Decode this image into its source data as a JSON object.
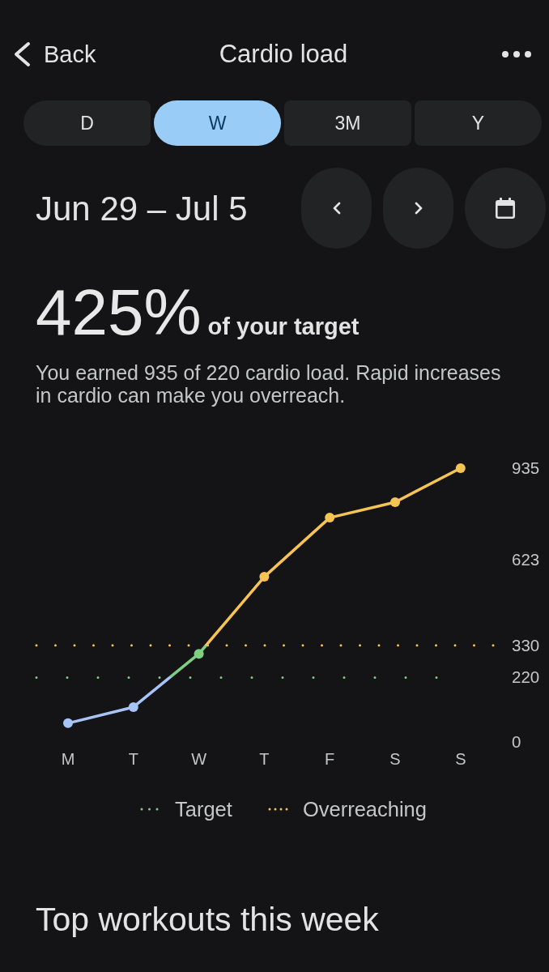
{
  "header": {
    "back": "Back",
    "title": "Cardio load"
  },
  "tabs": [
    {
      "label": "D",
      "selected": false
    },
    {
      "label": "W",
      "selected": true
    },
    {
      "label": "3M",
      "selected": false
    },
    {
      "label": "Y",
      "selected": false
    }
  ],
  "date_range": "Jun 29 – Jul 5",
  "summary": {
    "value": "425%",
    "caption": "of your target",
    "description": "You earned 935 of 220 cardio load. Rapid increases in cardio can make you overreach."
  },
  "chart": {
    "chart_data": {
      "type": "line",
      "categories": [
        "M",
        "T",
        "W",
        "T",
        "F",
        "S",
        "S"
      ],
      "series": [
        {
          "color": "#a7c3f7",
          "marker": "o",
          "values": [
            64,
            119,
            301,
            564,
            766,
            819,
            935
          ]
        }
      ],
      "ylim": [
        0,
        935
      ],
      "yticks": [
        0,
        220,
        330,
        623,
        935
      ],
      "ref_lines": [
        {
          "axis": "y",
          "value": 220,
          "label": "Target",
          "color": "#7fcf82"
        },
        {
          "axis": "y",
          "value": 330,
          "label": "Overreaching",
          "color": "#f7c454"
        }
      ]
    }
  },
  "section_title": "Top workouts this week"
}
